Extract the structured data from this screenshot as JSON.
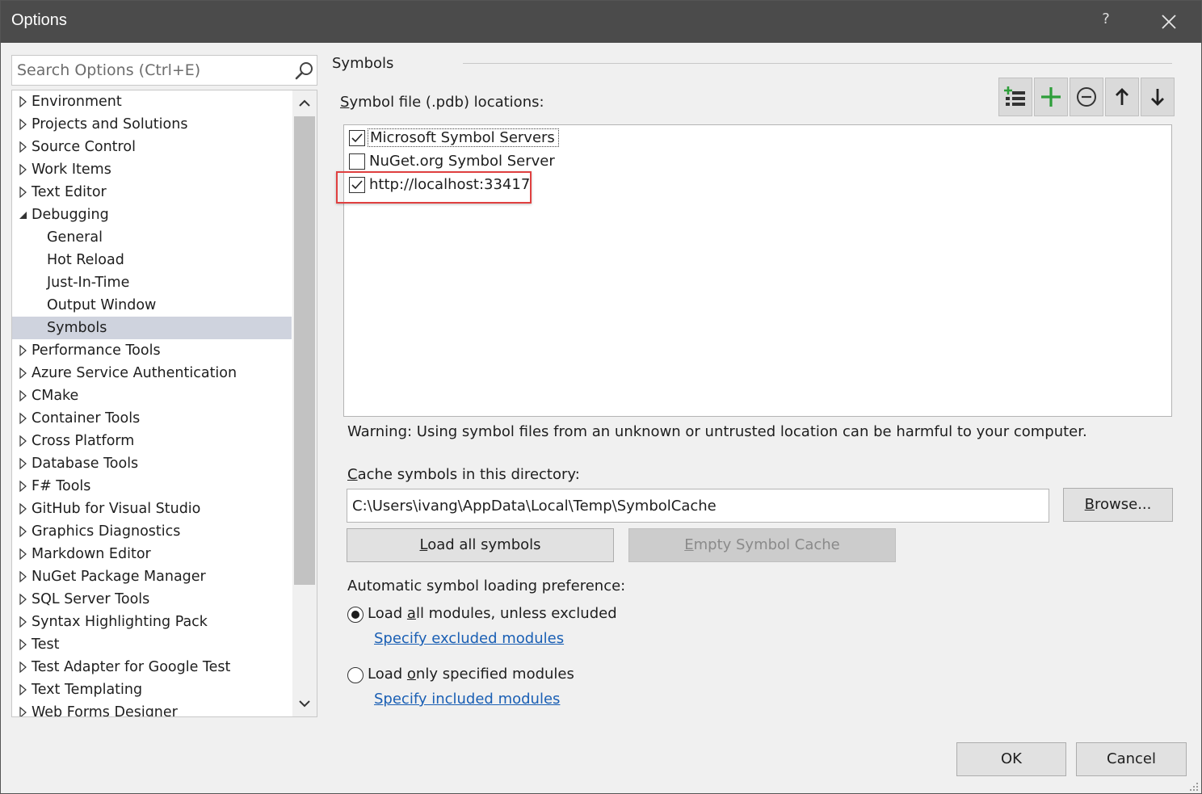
{
  "window": {
    "title": "Options",
    "help_label": "?"
  },
  "search": {
    "placeholder": "Search Options (Ctrl+E)"
  },
  "tree": {
    "items": [
      {
        "label": "Environment",
        "level": 0,
        "state": "collapsed"
      },
      {
        "label": "Projects and Solutions",
        "level": 0,
        "state": "collapsed"
      },
      {
        "label": "Source Control",
        "level": 0,
        "state": "collapsed"
      },
      {
        "label": "Work Items",
        "level": 0,
        "state": "collapsed"
      },
      {
        "label": "Text Editor",
        "level": 0,
        "state": "collapsed"
      },
      {
        "label": "Debugging",
        "level": 0,
        "state": "expanded"
      },
      {
        "label": "General",
        "level": 1
      },
      {
        "label": "Hot Reload",
        "level": 1
      },
      {
        "label": "Just-In-Time",
        "level": 1
      },
      {
        "label": "Output Window",
        "level": 1
      },
      {
        "label": "Symbols",
        "level": 1,
        "selected": true
      },
      {
        "label": "Performance Tools",
        "level": 0,
        "state": "collapsed"
      },
      {
        "label": "Azure Service Authentication",
        "level": 0,
        "state": "collapsed"
      },
      {
        "label": "CMake",
        "level": 0,
        "state": "collapsed"
      },
      {
        "label": "Container Tools",
        "level": 0,
        "state": "collapsed"
      },
      {
        "label": "Cross Platform",
        "level": 0,
        "state": "collapsed"
      },
      {
        "label": "Database Tools",
        "level": 0,
        "state": "collapsed"
      },
      {
        "label": "F# Tools",
        "level": 0,
        "state": "collapsed"
      },
      {
        "label": "GitHub for Visual Studio",
        "level": 0,
        "state": "collapsed"
      },
      {
        "label": "Graphics Diagnostics",
        "level": 0,
        "state": "collapsed"
      },
      {
        "label": "Markdown Editor",
        "level": 0,
        "state": "collapsed"
      },
      {
        "label": "NuGet Package Manager",
        "level": 0,
        "state": "collapsed"
      },
      {
        "label": "SQL Server Tools",
        "level": 0,
        "state": "collapsed"
      },
      {
        "label": "Syntax Highlighting Pack",
        "level": 0,
        "state": "collapsed"
      },
      {
        "label": "Test",
        "level": 0,
        "state": "collapsed"
      },
      {
        "label": "Test Adapter for Google Test",
        "level": 0,
        "state": "collapsed"
      },
      {
        "label": "Text Templating",
        "level": 0,
        "state": "collapsed"
      },
      {
        "label": "Web Forms Designer",
        "level": 0,
        "state": "collapsed"
      }
    ]
  },
  "symbols": {
    "section_title": "Symbols",
    "locations_label_underlined": "S",
    "locations_label_rest": "ymbol file (.pdb) locations:",
    "toolbar": [
      "add-server-icon",
      "plus-icon",
      "minus-icon",
      "arrow-up-icon",
      "arrow-down-icon"
    ],
    "locations": [
      {
        "label": "Microsoft Symbol Servers",
        "checked": true,
        "focused": true
      },
      {
        "label": "NuGet.org Symbol Server",
        "checked": false
      },
      {
        "label": "http://localhost:33417",
        "checked": true,
        "highlighted": true
      }
    ],
    "warning": "Warning: Using symbol files from an unknown or untrusted location can be harmful to your computer.",
    "cache_label_underlined": "C",
    "cache_label_rest": "ache symbols in this directory:",
    "cache_path": "C:\\Users\\ivang\\AppData\\Local\\Temp\\SymbolCache",
    "browse_underlined": "B",
    "browse_rest": "rowse...",
    "load_all_underlined": "L",
    "load_all_rest": "oad all symbols",
    "empty_cache_underlined": "E",
    "empty_cache_rest": "mpty Symbol Cache",
    "preference_label": "Automatic symbol loading preference:",
    "radio_all_pre": "Load ",
    "radio_all_underlined": "a",
    "radio_all_post": "ll modules, unless excluded",
    "radio_only_pre": "Load ",
    "radio_only_underlined": "o",
    "radio_only_post": "nly specified modules",
    "link_excluded": "Specify excluded modules",
    "link_included": "Specify included modules"
  },
  "footer": {
    "ok_label": "OK",
    "cancel_label": "Cancel"
  },
  "colors": {
    "titlebar": "#4b4b4b",
    "selection": "#cfd3de",
    "highlight_border": "#e04040",
    "link": "#1a5fb4",
    "plus_green": "#2e9e3a"
  }
}
